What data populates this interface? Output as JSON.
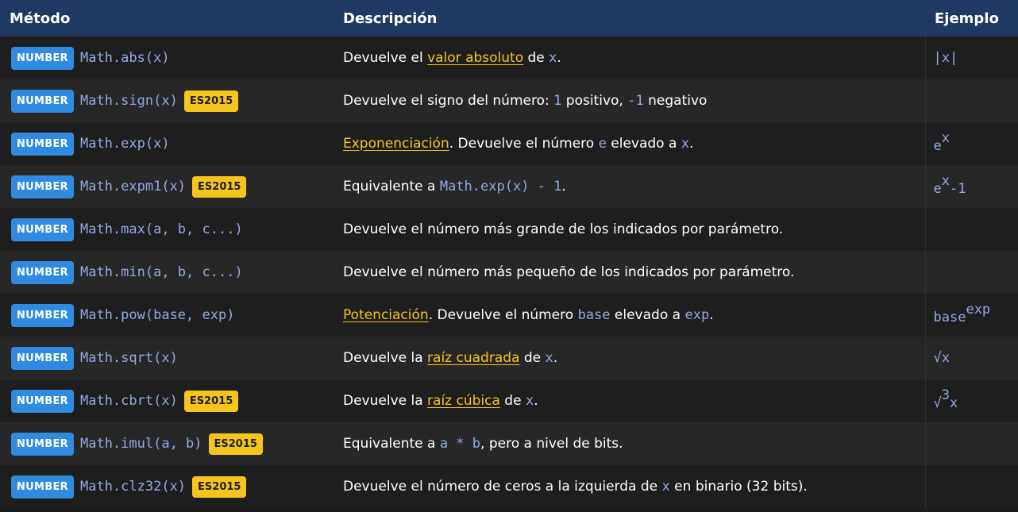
{
  "header": {
    "method": "Método",
    "description": "Descripción",
    "example": "Ejemplo"
  },
  "badges": {
    "number": "NUMBER",
    "es": "ES2015"
  },
  "colors": {
    "header_bg": "#1e3a63",
    "number_badge": "#2f8ae0",
    "es_badge": "#f5c51e",
    "code": "#93a9e3",
    "link": "#f5c51e"
  },
  "rows": [
    {
      "method": "Math.abs(x)",
      "desc": [
        "Devuelve el ",
        "valor absoluto",
        " de ",
        "x",
        "."
      ],
      "example": "|x|"
    },
    {
      "method": "Math.sign(x)",
      "desc": [
        "Devuelve el signo del número: ",
        "1",
        " positivo, ",
        "-1",
        " negativo"
      ]
    },
    {
      "method": "Math.exp(x)",
      "desc": [
        "Exponenciación",
        ". Devuelve el número ",
        "e",
        " elevado a ",
        "x",
        "."
      ],
      "example": [
        "e",
        "x"
      ]
    },
    {
      "method": "Math.expm1(x)",
      "desc": [
        "Equivalente a ",
        "Math.exp(x) - 1",
        "."
      ],
      "example": [
        "e",
        "x",
        "-1"
      ]
    },
    {
      "method": "Math.max(a, b, c...)",
      "desc": "Devuelve el número más grande de los indicados por parámetro."
    },
    {
      "method": "Math.min(a, b, c...)",
      "desc": "Devuelve el número más pequeño de los indicados por parámetro."
    },
    {
      "method": "Math.pow(base, exp)",
      "desc": [
        "Potenciación",
        ". Devuelve el número ",
        "base",
        " elevado a ",
        "exp",
        "."
      ],
      "example": [
        "base",
        "exp"
      ]
    },
    {
      "method": "Math.sqrt(x)",
      "desc": [
        "Devuelve la ",
        "raíz cuadrada",
        " de ",
        "x",
        "."
      ],
      "example": "√x"
    },
    {
      "method": "Math.cbrt(x)",
      "desc": [
        "Devuelve la ",
        "raíz cúbica",
        " de ",
        "x",
        "."
      ],
      "example": [
        "√",
        "3",
        "x"
      ]
    },
    {
      "method": "Math.imul(a, b)",
      "desc": [
        "Equivalente a ",
        "a * b",
        ", pero a nivel de bits."
      ]
    },
    {
      "method": "Math.clz32(x)",
      "desc": [
        "Devuelve el número de ceros a la izquierda de ",
        "x",
        " en binario (32 bits)."
      ]
    }
  ]
}
